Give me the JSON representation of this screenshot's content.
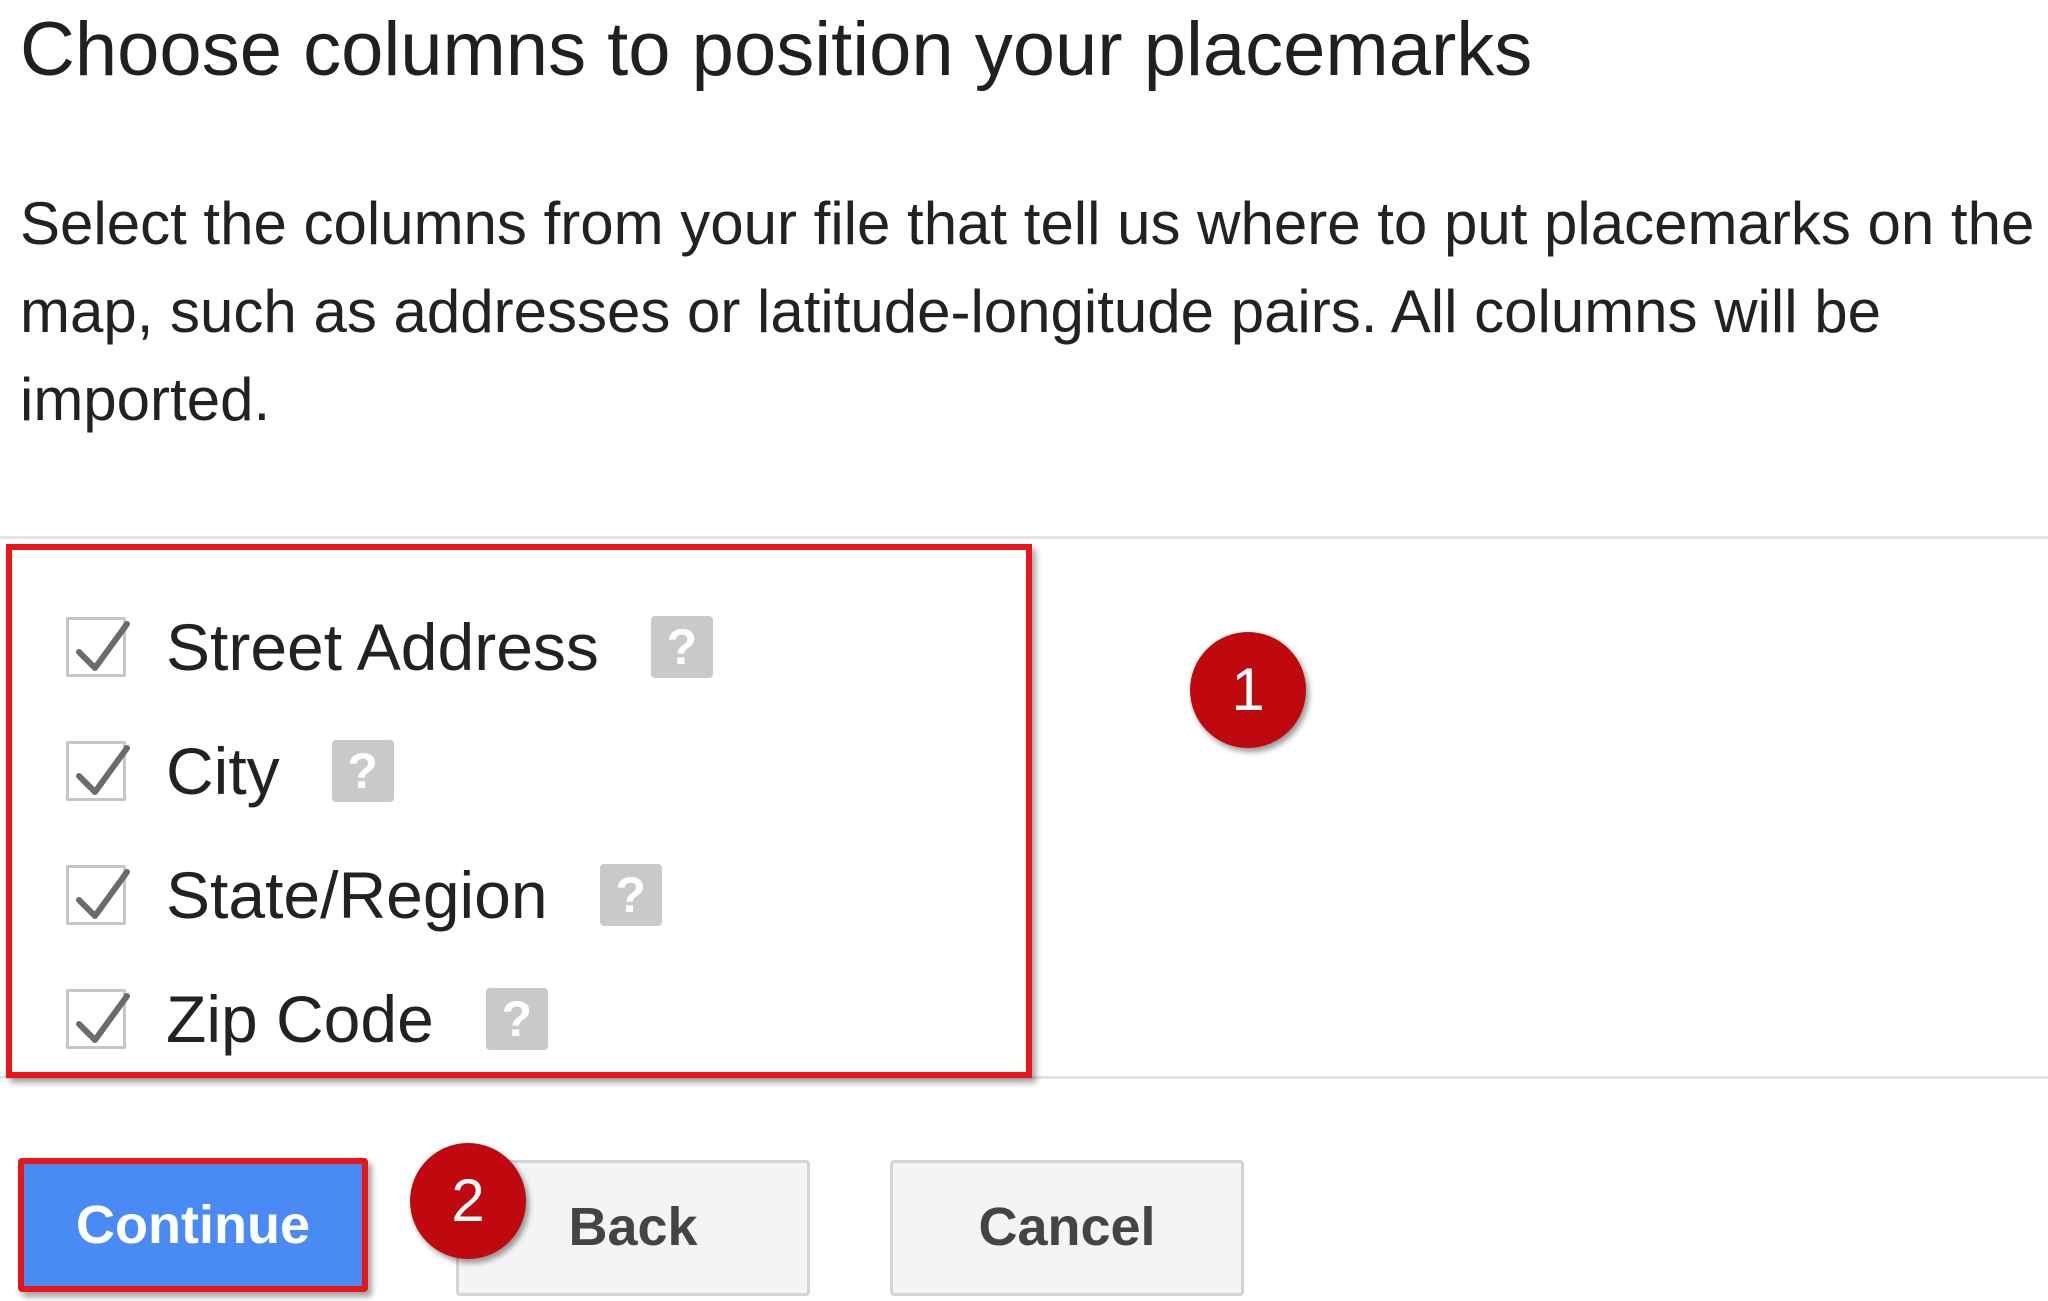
{
  "dialog": {
    "title": "Choose columns to position your placemarks",
    "description": "Select the columns from your file that tell us where to put placemarks on the map, such as addresses or latitude-longitude pairs. All columns will be imported."
  },
  "columns": [
    {
      "label": "Street Address",
      "checked": true,
      "help_icon": "question-icon"
    },
    {
      "label": "City",
      "checked": true,
      "help_icon": "question-icon"
    },
    {
      "label": "State/Region",
      "checked": true,
      "help_icon": "question-icon"
    },
    {
      "label": "Zip Code",
      "checked": true,
      "help_icon": "question-icon"
    }
  ],
  "help_glyph": "?",
  "annotations": {
    "step1": "1",
    "step2": "2",
    "highlight_color": "#e8151b",
    "badge_color": "#c0090f"
  },
  "buttons": {
    "continue": "Continue",
    "back": "Back",
    "cancel": "Cancel"
  },
  "colors": {
    "primary": "#4a8af4",
    "secondary_button_bg": "#f4f4f4"
  }
}
